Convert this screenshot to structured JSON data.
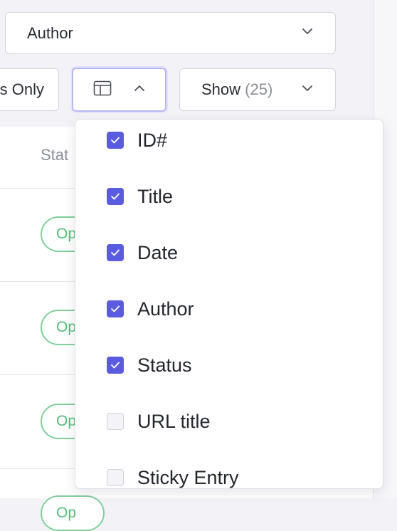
{
  "author_select": {
    "value": "Author"
  },
  "toolbar": {
    "only_label": "s Only",
    "show_label": "Show",
    "show_count": "(25)"
  },
  "table": {
    "status_header": "Stat",
    "pill_text": "Op"
  },
  "columns_menu": {
    "items": [
      {
        "label": "ID#",
        "checked": true
      },
      {
        "label": "Title",
        "checked": true
      },
      {
        "label": "Date",
        "checked": true
      },
      {
        "label": "Author",
        "checked": true
      },
      {
        "label": "Status",
        "checked": true
      },
      {
        "label": "URL title",
        "checked": false
      },
      {
        "label": "Sticky Entry",
        "checked": false
      }
    ]
  },
  "colors": {
    "accent": "#5b5be0",
    "status_green": "#53bd76"
  },
  "icons": {
    "columns_button": "layout-columns-icon",
    "caret_open": "chevron-up-icon",
    "caret_closed": "chevron-down-icon",
    "check": "check-icon"
  }
}
